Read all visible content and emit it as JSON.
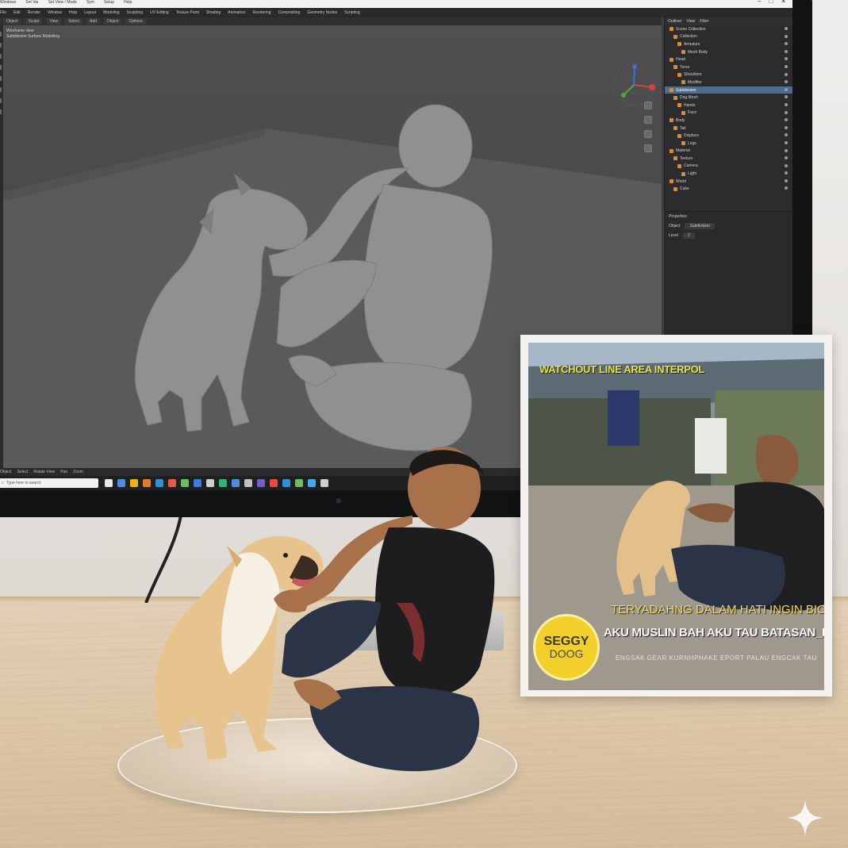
{
  "blender": {
    "menubar": [
      "Windows",
      "Set Var",
      "Set View / Mode",
      "Sym",
      "Setup",
      "Help"
    ],
    "topmenu": [
      "File",
      "Edit",
      "Render",
      "Window",
      "Help",
      "Layout",
      "Modeling",
      "Sculpting",
      "UV Editing",
      "Texture Paint",
      "Shading",
      "Animation",
      "Rendering",
      "Compositing",
      "Geometry Nodes",
      "Scripting"
    ],
    "tabs": [
      "Object",
      "Sculpt",
      "View",
      "Select",
      "Add",
      "Object",
      "Options"
    ],
    "viewport_info": [
      "Wireframe view",
      "Subdivision Surface  Modelling"
    ],
    "outliner_tabs": [
      "Outliner",
      "View",
      "Filter"
    ],
    "outliner_rows": [
      {
        "label": "Scene Collection",
        "selected": false
      },
      {
        "label": "Collection",
        "selected": false
      },
      {
        "label": "Armature",
        "selected": false
      },
      {
        "label": "Mesh Body",
        "selected": false
      },
      {
        "label": "Head",
        "selected": false
      },
      {
        "label": "Torso",
        "selected": false
      },
      {
        "label": "Shoulders",
        "selected": false
      },
      {
        "label": "Modifier",
        "selected": false
      },
      {
        "label": "Subdivision",
        "selected": true
      },
      {
        "label": "Dog Mesh",
        "selected": false
      },
      {
        "label": "Hands",
        "selected": false
      },
      {
        "label": "Face",
        "selected": false
      },
      {
        "label": "Body",
        "selected": false
      },
      {
        "label": "Tail",
        "selected": false
      },
      {
        "label": "Displace",
        "selected": false
      },
      {
        "label": "Legs",
        "selected": false
      },
      {
        "label": "Material",
        "selected": false
      },
      {
        "label": "Texture",
        "selected": false
      },
      {
        "label": "Camera",
        "selected": false
      },
      {
        "label": "Light",
        "selected": false
      },
      {
        "label": "World",
        "selected": false
      },
      {
        "label": "Cube",
        "selected": false
      }
    ],
    "props_header": "Properties",
    "props_rows": [
      {
        "label": "Object",
        "value": "Subdivision"
      },
      {
        "label": "Level",
        "value": "2"
      }
    ],
    "statusbar": [
      "Object",
      "Select",
      "Rotate View",
      "Pan",
      "Zoom"
    ],
    "taskbar_search_placeholder": "Type here to search",
    "taskbar_icons": [
      "#e8e8e8",
      "#4a90d9",
      "#f1b400",
      "#e8792b",
      "#2f8fd8",
      "#ea5a3c",
      "#6bbf59",
      "#3b7de0",
      "#d0d0d0",
      "#2bb673",
      "#4a90d9",
      "#c1c1c1",
      "#7a5cc9",
      "#e84c3d",
      "#2f8fd8",
      "#6bbf59",
      "#3fa9f5",
      "#d0d0d0"
    ]
  },
  "poster": {
    "title": "WATCHOUT LINE AREA INTERPOL",
    "subtitle": "TERYADAHNG DALAM HATI INGIN BICARA",
    "main_line": "AKU MUSLIN BAH AKU TAU BATASAN_BATASAN NAJIS",
    "small_line": "ENGSAK GEAR KURNHPHAKE EPORT PALAU ENGCAK TAU",
    "badge_top": "SEGGY",
    "badge_bottom": "DOOG"
  },
  "scene": {
    "colors": {
      "viewport_model": "#8f9092",
      "dog_fur": "#e7c48e",
      "shirt": "#1d1d1f",
      "jeans": "#2a3446",
      "skin": "#a9714a",
      "badge": "#f2cf2a"
    }
  }
}
